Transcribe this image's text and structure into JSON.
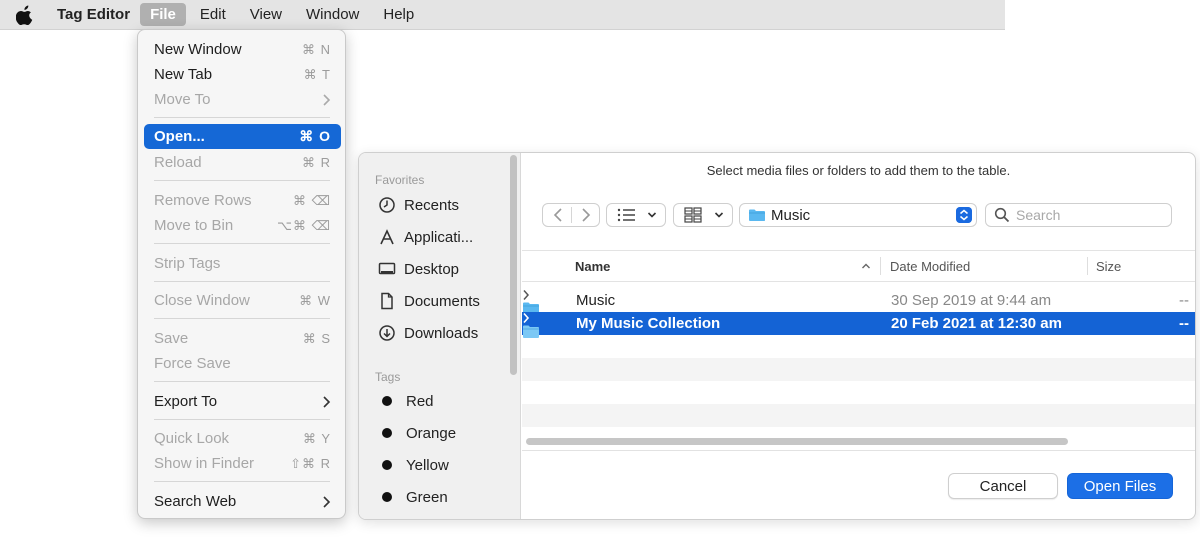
{
  "menubar": {
    "app_name": "Tag Editor",
    "items": [
      "File",
      "Edit",
      "View",
      "Window",
      "Help"
    ],
    "active_item": "File"
  },
  "file_menu": {
    "items": [
      {
        "label": "New Window",
        "shortcut": "⌘ N",
        "enabled": true
      },
      {
        "label": "New Tab",
        "shortcut": "⌘ T",
        "enabled": true
      },
      {
        "label": "Move To",
        "shortcut": "",
        "submenu": true,
        "enabled": false
      },
      {
        "label": "Open...",
        "shortcut": "⌘ O",
        "enabled": true,
        "highlighted": true
      },
      {
        "label": "Reload",
        "shortcut": "⌘ R",
        "enabled": false
      },
      {
        "label": "Remove Rows",
        "shortcut": "⌘ ⌫",
        "enabled": false
      },
      {
        "label": "Move to Bin",
        "shortcut": "⌥⌘ ⌫",
        "enabled": false
      },
      {
        "label": "Strip Tags",
        "shortcut": "",
        "enabled": false
      },
      {
        "label": "Close Window",
        "shortcut": "⌘ W",
        "enabled": false
      },
      {
        "label": "Save",
        "shortcut": "⌘ S",
        "enabled": false
      },
      {
        "label": "Force Save",
        "shortcut": "",
        "enabled": false
      },
      {
        "label": "Export To",
        "shortcut": "",
        "submenu": true,
        "enabled": true
      },
      {
        "label": "Quick Look",
        "shortcut": "⌘ Y",
        "enabled": false
      },
      {
        "label": "Show in Finder",
        "shortcut": "⇧⌘ R",
        "enabled": false
      },
      {
        "label": "Search Web",
        "shortcut": "",
        "submenu": true,
        "enabled": true
      }
    ]
  },
  "dialog": {
    "message": "Select media files or folders to add them to the table.",
    "sidebar": {
      "favorites_label": "Favorites",
      "favorites": [
        {
          "label": "Recents",
          "icon": "clock-icon"
        },
        {
          "label": "Applicati...",
          "icon": "applications-icon"
        },
        {
          "label": "Desktop",
          "icon": "desktop-icon"
        },
        {
          "label": "Documents",
          "icon": "document-icon"
        },
        {
          "label": "Downloads",
          "icon": "download-icon"
        }
      ],
      "tags_label": "Tags",
      "tags": [
        {
          "label": "Red",
          "color": "#111111"
        },
        {
          "label": "Orange",
          "color": "#111111"
        },
        {
          "label": "Yellow",
          "color": "#111111"
        },
        {
          "label": "Green",
          "color": "#111111"
        }
      ]
    },
    "location": "Music",
    "search_placeholder": "Search",
    "columns": {
      "name": "Name",
      "date": "Date Modified",
      "size": "Size"
    },
    "rows": [
      {
        "name": "Music",
        "date": "30 Sep 2019 at 9:44 am",
        "size": "--",
        "selected": false
      },
      {
        "name": "My Music Collection",
        "date": "20 Feb 2021 at 12:30 am",
        "size": "--",
        "selected": true
      }
    ],
    "cancel_label": "Cancel",
    "open_label": "Open Files"
  },
  "colors": {
    "accent": "#1568d6",
    "selection": "#1463d5",
    "menubar_bg": "#e4e4e4",
    "folder": "#5ab8f0"
  }
}
